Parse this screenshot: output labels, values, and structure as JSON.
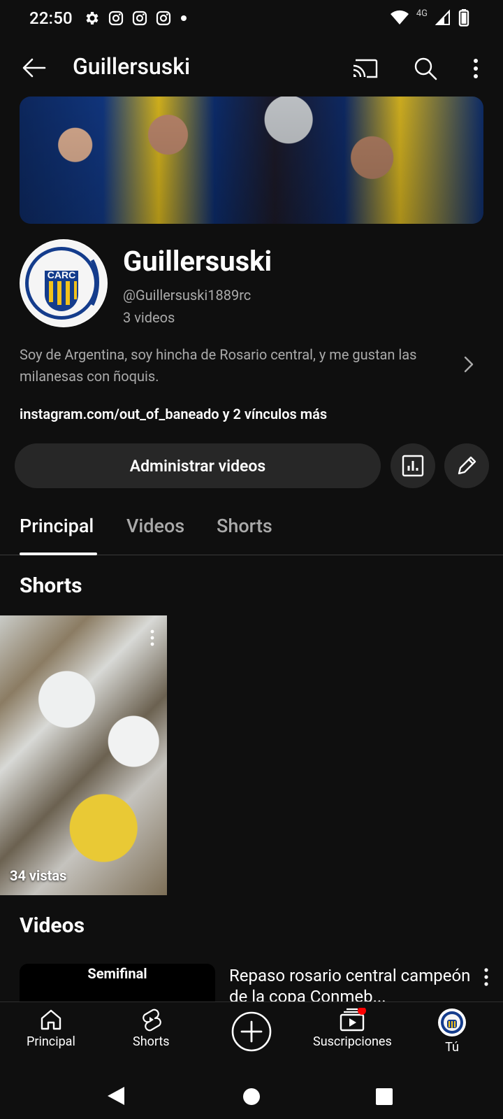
{
  "status_bar": {
    "time": "22:50",
    "network": "4G"
  },
  "topbar": {
    "title": "Guillersuski"
  },
  "channel": {
    "name": "Guillersuski",
    "handle": "@Guillersuski1889rc",
    "video_count": "3 videos",
    "description": "Soy de Argentina, soy hincha de Rosario central, y me gustan las milanesas con ñoquis.",
    "links": "instagram.com/out_of_baneado y 2 vínculos más",
    "avatar_text": "CARC"
  },
  "actions": {
    "manage_label": "Administrar videos"
  },
  "tabs": [
    {
      "label": "Principal",
      "active": true
    },
    {
      "label": "Videos",
      "active": false
    },
    {
      "label": "Shorts",
      "active": false
    }
  ],
  "shorts_section": {
    "title": "Shorts",
    "items": [
      {
        "views": "34 vistas"
      }
    ]
  },
  "videos_section": {
    "title": "Videos",
    "items": [
      {
        "thumb_label": "Semifinal",
        "title": "Repaso rosario central campeón de la copa Conmeb..."
      }
    ]
  },
  "bottom_nav": [
    {
      "label": "Principal",
      "icon": "home-icon"
    },
    {
      "label": "Shorts",
      "icon": "shorts-icon"
    },
    {
      "label": "",
      "icon": "create-icon"
    },
    {
      "label": "Suscripciones",
      "icon": "subscriptions-icon"
    },
    {
      "label": "Tú",
      "icon": "you-avatar"
    }
  ],
  "colors": {
    "background": "#0f0f0f",
    "surface": "#272727",
    "secondary_text": "#aaaaaa",
    "notification_dot": "#ff0000"
  }
}
